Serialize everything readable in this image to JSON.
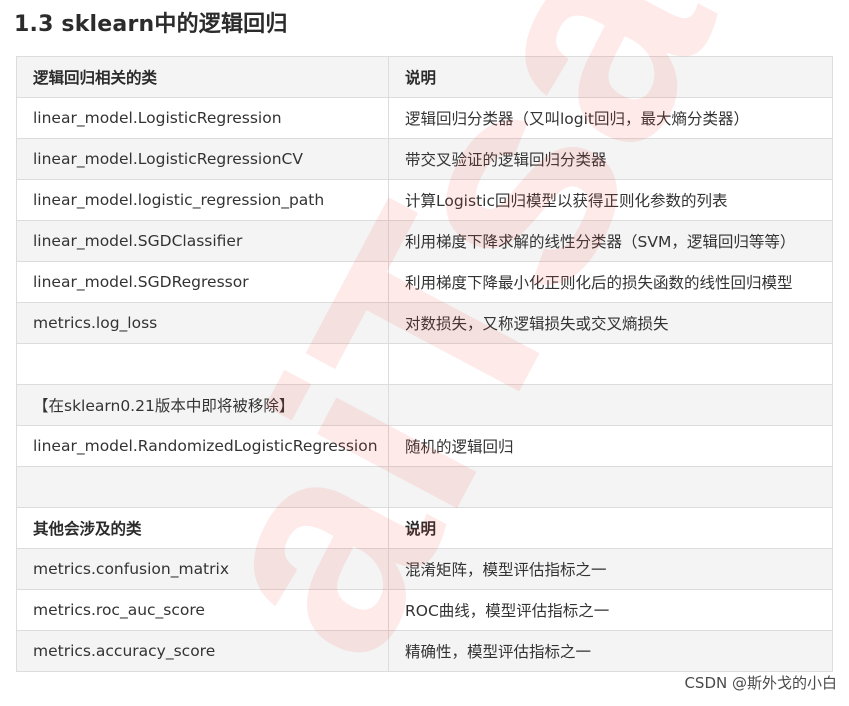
{
  "heading": "1.3 sklearn中的逻辑回归",
  "rows": [
    {
      "name": "逻辑回归相关的类",
      "desc": "说明",
      "kind": "header"
    },
    {
      "name": "linear_model.LogisticRegression",
      "desc": "逻辑回归分类器（又叫logit回归，最大熵分类器）",
      "kind": "data"
    },
    {
      "name": "linear_model.LogisticRegressionCV",
      "desc": "带交叉验证的逻辑回归分类器",
      "kind": "data"
    },
    {
      "name": "linear_model.logistic_regression_path",
      "desc": "计算Logistic回归模型以获得正则化参数的列表",
      "kind": "data"
    },
    {
      "name": "linear_model.SGDClassifier",
      "desc": "利用梯度下降求解的线性分类器（SVM，逻辑回归等等）",
      "kind": "data"
    },
    {
      "name": "linear_model.SGDRegressor",
      "desc": "利用梯度下降最小化正则化后的损失函数的线性回归模型",
      "kind": "data"
    },
    {
      "name": "metrics.log_loss",
      "desc": "对数损失，又称逻辑损失或交叉熵损失",
      "kind": "data"
    },
    {
      "name": "",
      "desc": "",
      "kind": "empty"
    },
    {
      "name": "【在sklearn0.21版本中即将被移除】",
      "desc": "",
      "kind": "data"
    },
    {
      "name": "linear_model.RandomizedLogisticRegression",
      "desc": "随机的逻辑回归",
      "kind": "data"
    },
    {
      "name": "",
      "desc": "",
      "kind": "empty"
    },
    {
      "name": "其他会涉及的类",
      "desc": "说明",
      "kind": "header"
    },
    {
      "name": "metrics.confusion_matrix",
      "desc": "混淆矩阵，模型评估指标之一",
      "kind": "data"
    },
    {
      "name": "metrics.roc_auc_score",
      "desc": "ROC曲线，模型评估指标之一",
      "kind": "data"
    },
    {
      "name": "metrics.accuracy_score",
      "desc": "精确性，模型评估指标之一",
      "kind": "data"
    }
  ],
  "watermark": "aiTsai",
  "credit": "CSDN @斯外戈的小白"
}
